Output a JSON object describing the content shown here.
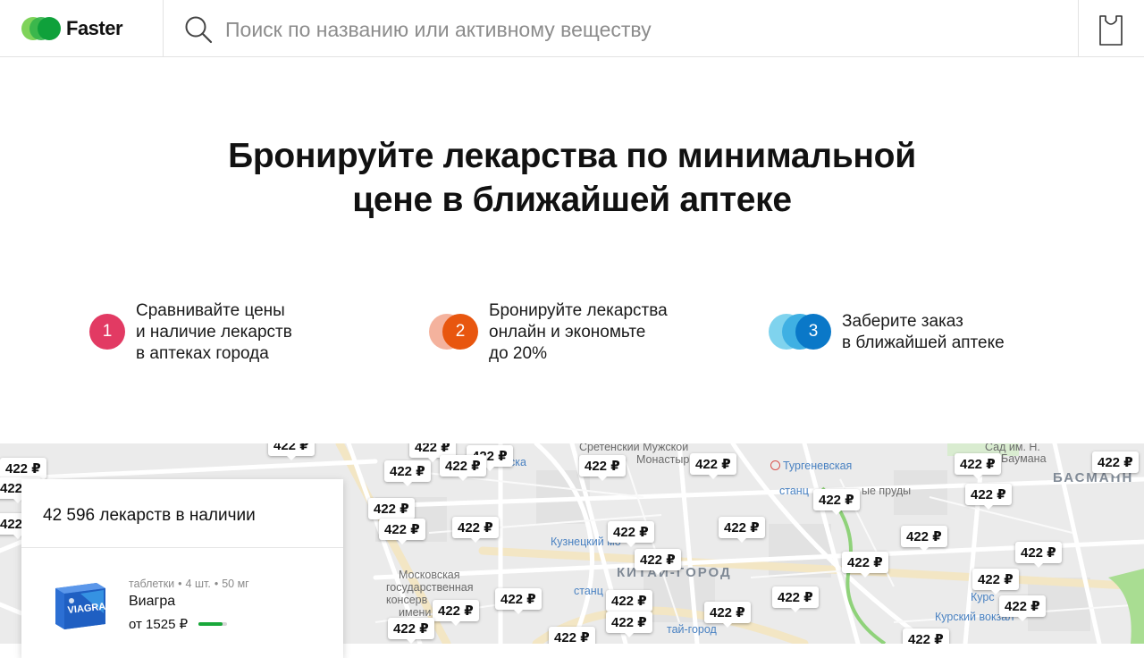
{
  "header": {
    "logo_text": "Faster",
    "search_placeholder": "Поиск по названию или активному веществу"
  },
  "hero": {
    "title_line1": "Бронируйте лекарства по минимальной",
    "title_line2": "цене в ближайшей аптеке"
  },
  "steps": [
    {
      "number": "1",
      "lines": [
        "Сравнивайте цены",
        "и наличие лекарств",
        "в аптеках города"
      ],
      "color": "#e23a63"
    },
    {
      "number": "2",
      "lines": [
        "Бронируйте лекарства",
        "онлайн и экономьте",
        "до 20%"
      ],
      "color": "#e8560f"
    },
    {
      "number": "3",
      "lines": [
        "Заберите заказ",
        "в ближайшей аптеке"
      ],
      "color": "#0a78c8"
    }
  ],
  "map": {
    "pin_price": "422 ₽",
    "labels": {
      "sretensky": "Сретенский Мужской",
      "monastyr": "Монастырь",
      "turgenevskaya": "Тургеневская",
      "stancia": "станц",
      "chistye_prudy": "ые пруды",
      "basmanny": "БАСМАНН",
      "sad_im": "Сад им. Н.",
      "baumana": "Баумана",
      "kuznetsky": "Кузнецкий мо",
      "kitay_gorod": "КИТАЙ-ГОРОД",
      "moskovskaya": "Московская",
      "gosudarstvennaya": "государственная",
      "konserv": "консерв",
      "imeni": "имени",
      "kitay_gorod2": "тай-город",
      "kursky": "Курский вокзал",
      "kurs": "Курс",
      "tverskoy": "Тверской",
      "ska": "ска",
      "stanc2": "станц"
    }
  },
  "panel": {
    "title": "42 596 лекарств в наличии",
    "product": {
      "form": "таблетки",
      "count": "4 шт.",
      "dose": "50 мг",
      "name": "Виагра",
      "price": "от 1525 ₽",
      "availability": 0.85,
      "box_label": "VIAGRA"
    }
  },
  "colors": {
    "brand_green": "#19a83a",
    "step1": "#e23a63",
    "step2": "#e8560f",
    "step3": "#0a78c8"
  }
}
